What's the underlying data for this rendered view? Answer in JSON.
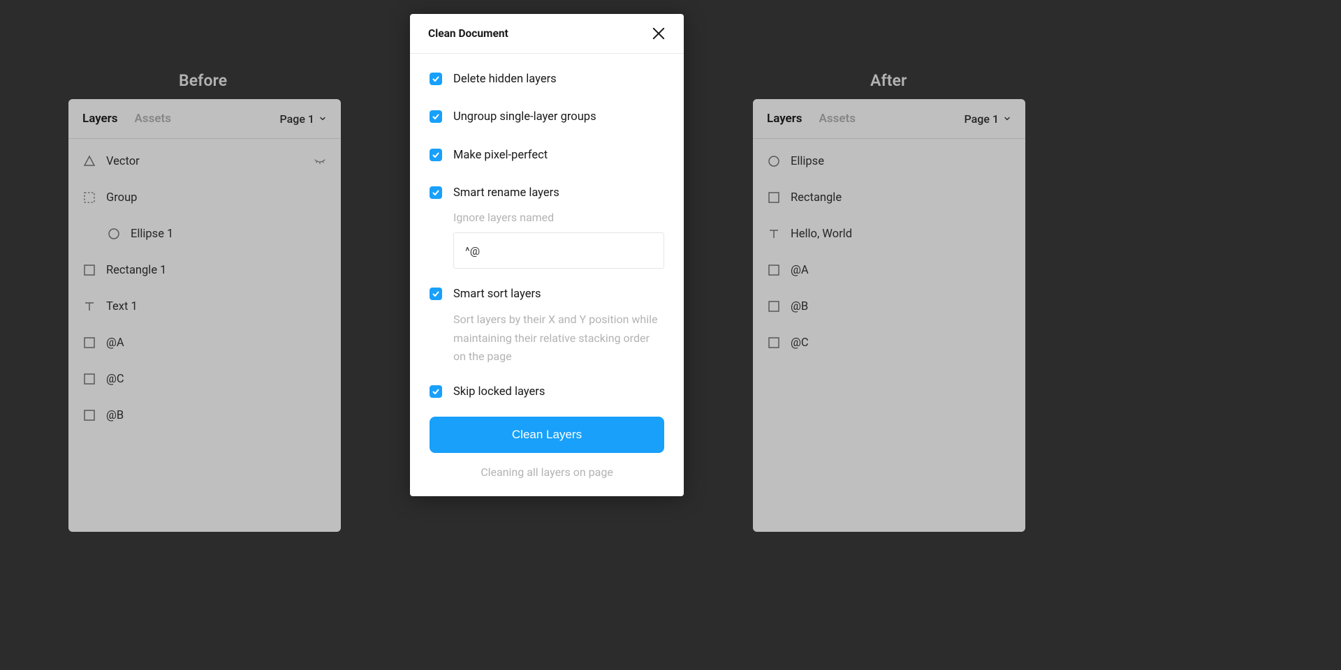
{
  "columns": {
    "before_label": "Before",
    "after_label": "After"
  },
  "panel": {
    "tabs": {
      "layers": "Layers",
      "assets": "Assets"
    },
    "page": "Page 1"
  },
  "before_layers": [
    {
      "icon": "triangle",
      "name": "Vector",
      "hidden": true
    },
    {
      "icon": "group",
      "name": "Group"
    },
    {
      "icon": "circle",
      "name": "Ellipse 1",
      "indent": 1
    },
    {
      "icon": "square",
      "name": "Rectangle 1"
    },
    {
      "icon": "text",
      "name": "Text 1"
    },
    {
      "icon": "square",
      "name": "@A"
    },
    {
      "icon": "square",
      "name": "@C"
    },
    {
      "icon": "square",
      "name": "@B"
    }
  ],
  "after_layers": [
    {
      "icon": "circle",
      "name": "Ellipse"
    },
    {
      "icon": "square",
      "name": "Rectangle"
    },
    {
      "icon": "text",
      "name": "Hello, World"
    },
    {
      "icon": "square",
      "name": "@A"
    },
    {
      "icon": "square",
      "name": "@B"
    },
    {
      "icon": "square",
      "name": "@C"
    }
  ],
  "modal": {
    "title": "Clean Document",
    "options": {
      "delete_hidden": "Delete hidden layers",
      "ungroup_single": "Ungroup single-layer groups",
      "pixel_perfect": "Make pixel-perfect",
      "smart_rename": "Smart rename layers",
      "ignore_label": "Ignore layers named",
      "ignore_value": "^@",
      "smart_sort": "Smart sort layers",
      "smart_sort_desc": "Sort layers by their X and Y position while maintaining their relative stacking order on the page",
      "skip_locked": "Skip locked layers"
    },
    "button": "Clean Layers",
    "hint": "Cleaning all layers on page"
  }
}
